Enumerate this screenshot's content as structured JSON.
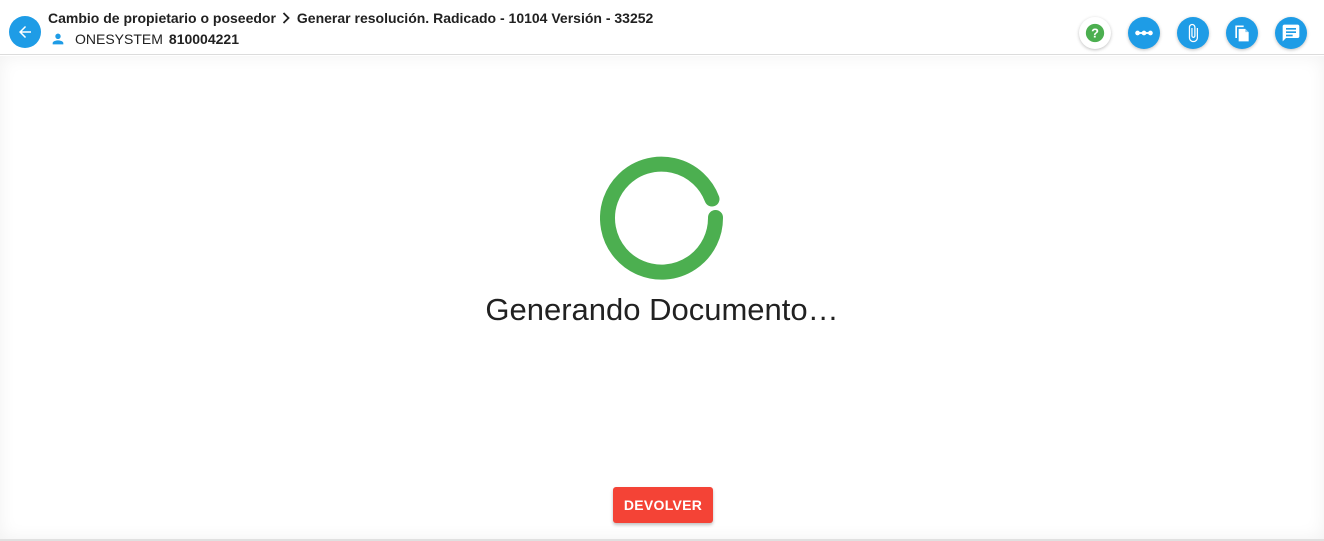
{
  "header": {
    "breadcrumb": {
      "parent": "Cambio de propietario o poseedor",
      "current": "Generar resolución. Radicado - 10104 Versión - 33252"
    },
    "user": {
      "name": "ONESYSTEM",
      "id": "810004221"
    },
    "toolbar": [
      {
        "name": "help",
        "icon": "help-icon"
      },
      {
        "name": "flow",
        "icon": "flow-icon"
      },
      {
        "name": "attachments",
        "icon": "paperclip-icon"
      },
      {
        "name": "documents",
        "icon": "copy-icon"
      },
      {
        "name": "comments",
        "icon": "comment-icon"
      }
    ]
  },
  "main": {
    "loading_text": "Generando Documento…",
    "return_label": "DEVOLVER"
  },
  "colors": {
    "accent": "#1e9ce6",
    "spinner": "#4caf50",
    "danger": "#f44336"
  }
}
